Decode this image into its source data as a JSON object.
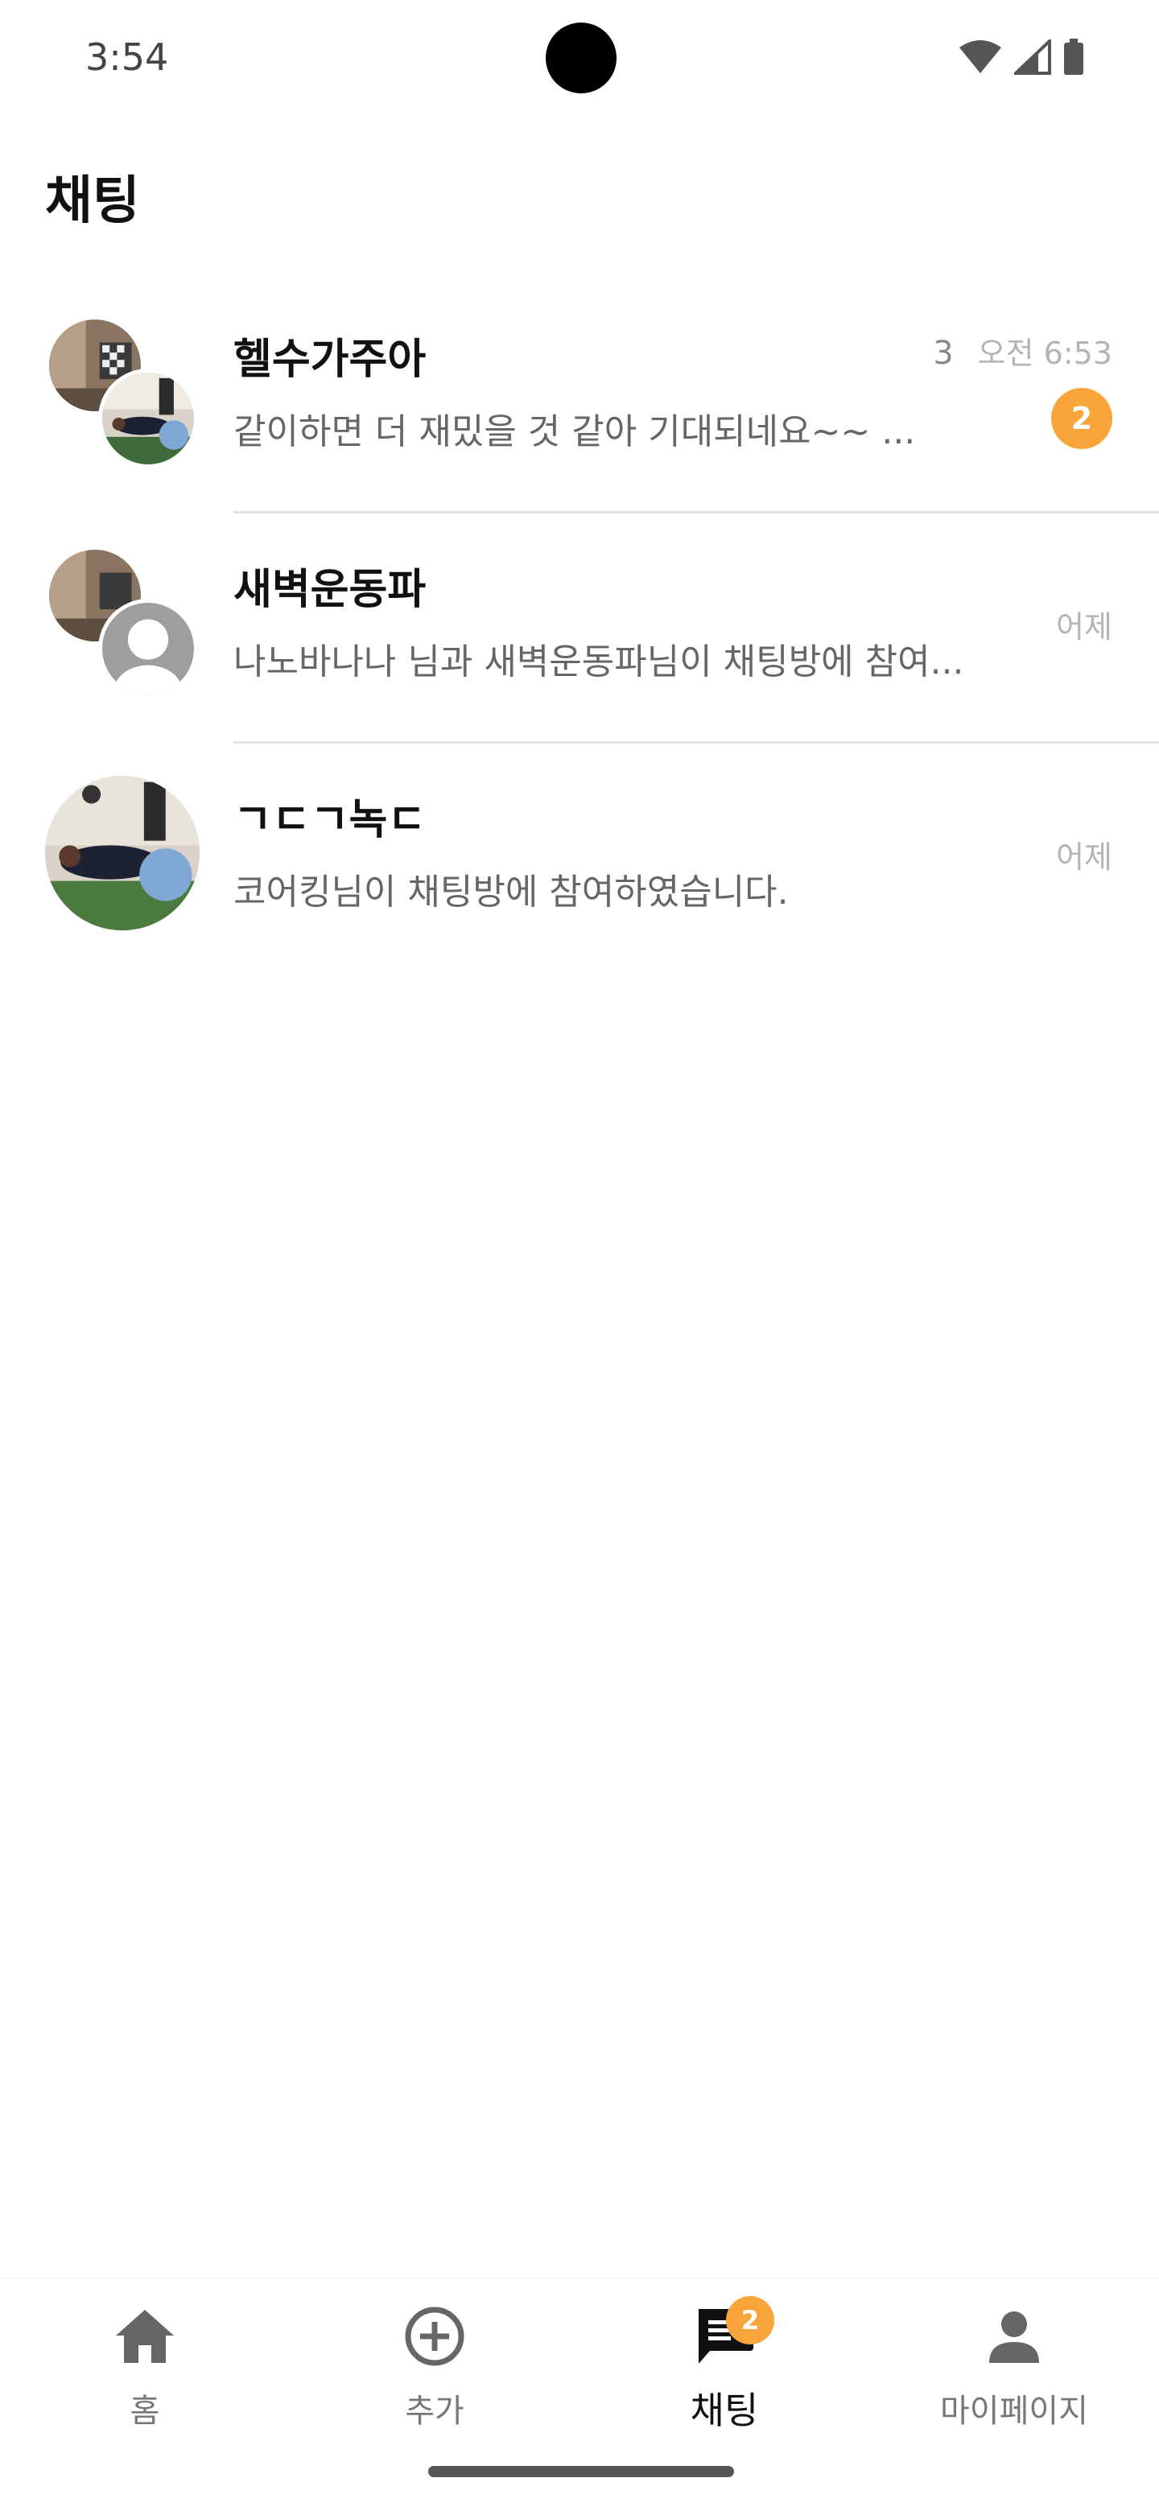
{
  "status_bar": {
    "time": "3:54"
  },
  "header": {
    "title": "채팅"
  },
  "chats": [
    {
      "name": "헬수가주아",
      "preview": "같이하면 더 재밌을 것 같아 기대되네요~~ ...",
      "member_count": "3",
      "time": "오전 6:53",
      "unread": "2"
    },
    {
      "name": "새벽운동파",
      "preview": "나노바나나 님과 새벽운동파님이 채팅방에 참여...",
      "time": "어제"
    },
    {
      "name": "ㄱㄷㄱ녹ㄷ",
      "preview": "코어킹님이 채팅방에 참여하였습니다.",
      "time": "어제"
    }
  ],
  "nav": {
    "home_label": "홈",
    "add_label": "추가",
    "chat_label": "채팅",
    "chat_badge": "2",
    "mypage_label": "마이페이지"
  },
  "colors": {
    "accent": "#f9a53b",
    "divider": "#e4e4e4"
  }
}
